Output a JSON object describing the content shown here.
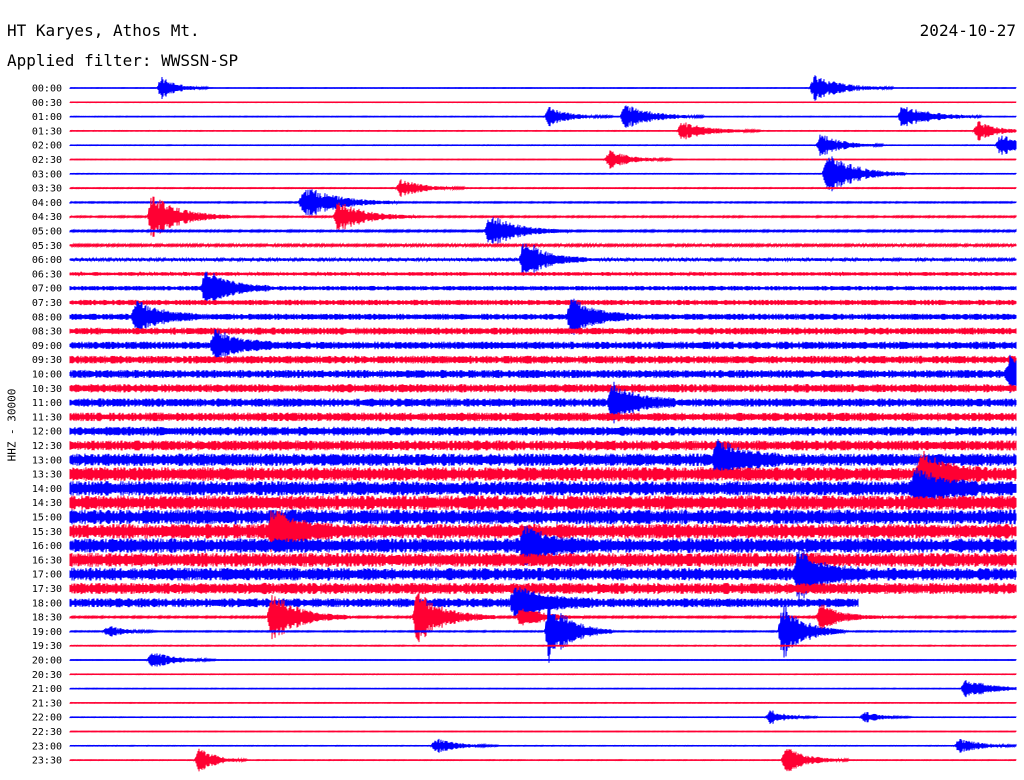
{
  "header": {
    "station": "HT Karyes, Athos Mt.",
    "date": "2024-10-27",
    "filter": "Applied filter: WWSSN-SP"
  },
  "colors": {
    "trace_even": "#0000ff",
    "trace_odd": "#ff0033",
    "background": "#ffffff",
    "text": "#000000"
  },
  "chart_data": {
    "type": "helicorder",
    "ylabel": "HHZ - 30000",
    "row_labels": [
      "00:00",
      "00:30",
      "01:00",
      "01:30",
      "02:00",
      "02:30",
      "03:00",
      "03:30",
      "04:00",
      "04:30",
      "05:00",
      "05:30",
      "06:00",
      "06:30",
      "07:00",
      "07:30",
      "08:00",
      "08:30",
      "09:00",
      "09:30",
      "10:00",
      "10:30",
      "11:00",
      "11:30",
      "12:00",
      "12:30",
      "13:00",
      "13:30",
      "14:00",
      "14:30",
      "15:00",
      "15:30",
      "16:00",
      "16:30",
      "17:00",
      "17:30",
      "18:00",
      "18:30",
      "19:00",
      "19:30",
      "20:00",
      "20:30",
      "21:00",
      "21:30",
      "22:00",
      "22:30",
      "23:00",
      "23:30"
    ],
    "row_minutes": 30,
    "color_order": [
      "blue",
      "red"
    ],
    "noise_level": [
      0.15,
      0.15,
      0.2,
      0.2,
      0.2,
      0.2,
      0.25,
      0.3,
      0.4,
      0.5,
      0.6,
      0.8,
      1.0,
      1.3,
      1.6,
      1.9,
      2.2,
      2.5,
      2.7,
      2.8,
      2.9,
      3.0,
      3.0,
      3.1,
      3.2,
      3.6,
      4.5,
      5.0,
      5.2,
      5.2,
      5.3,
      5.3,
      5.2,
      5.0,
      4.6,
      4.0,
      3.2,
      0.6,
      0.4,
      0.3,
      0.25,
      0.2,
      0.2,
      0.2,
      0.2,
      0.2,
      0.2,
      0.2
    ],
    "bursts": [
      {
        "row": 0,
        "minute": 2.9,
        "amplitude": 12,
        "duration": 1.5
      },
      {
        "row": 0,
        "minute": 23.6,
        "amplitude": 14,
        "duration": 2.5
      },
      {
        "row": 2,
        "minute": 15.2,
        "amplitude": 10,
        "duration": 2.0
      },
      {
        "row": 2,
        "minute": 17.6,
        "amplitude": 14,
        "duration": 2.5
      },
      {
        "row": 2,
        "minute": 26.4,
        "amplitude": 14,
        "duration": 2.5
      },
      {
        "row": 3,
        "minute": 19.4,
        "amplitude": 10,
        "duration": 2.5
      },
      {
        "row": 3,
        "minute": 28.8,
        "amplitude": 10,
        "duration": 1.8
      },
      {
        "row": 4,
        "minute": 23.8,
        "amplitude": 12,
        "duration": 2.0
      },
      {
        "row": 4,
        "minute": 29.5,
        "amplitude": 12,
        "duration": 2.0
      },
      {
        "row": 5,
        "minute": 17.1,
        "amplitude": 10,
        "duration": 2.0
      },
      {
        "row": 6,
        "minute": 24.0,
        "amplitude": 24,
        "duration": 2.5
      },
      {
        "row": 7,
        "minute": 10.5,
        "amplitude": 10,
        "duration": 2.0
      },
      {
        "row": 8,
        "minute": 7.4,
        "amplitude": 18,
        "duration": 3.0
      },
      {
        "row": 9,
        "minute": 2.6,
        "amplitude": 24,
        "duration": 2.5
      },
      {
        "row": 9,
        "minute": 8.5,
        "amplitude": 16,
        "duration": 2.5
      },
      {
        "row": 10,
        "minute": 13.3,
        "amplitude": 18,
        "duration": 2.5
      },
      {
        "row": 12,
        "minute": 14.4,
        "amplitude": 22,
        "duration": 2.0
      },
      {
        "row": 14,
        "minute": 4.3,
        "amplitude": 20,
        "duration": 2.0
      },
      {
        "row": 16,
        "minute": 2.1,
        "amplitude": 18,
        "duration": 2.0
      },
      {
        "row": 16,
        "minute": 15.9,
        "amplitude": 20,
        "duration": 2.0
      },
      {
        "row": 18,
        "minute": 4.6,
        "amplitude": 16,
        "duration": 2.0
      },
      {
        "row": 20,
        "minute": 29.8,
        "amplitude": 18,
        "duration": 2.0
      },
      {
        "row": 22,
        "minute": 17.2,
        "amplitude": 20,
        "duration": 2.0
      },
      {
        "row": 26,
        "minute": 20.5,
        "amplitude": 20,
        "duration": 2.0
      },
      {
        "row": 27,
        "minute": 27.0,
        "amplitude": 22,
        "duration": 2.0
      },
      {
        "row": 28,
        "minute": 26.8,
        "amplitude": 20,
        "duration": 2.0
      },
      {
        "row": 31,
        "minute": 6.4,
        "amplitude": 20,
        "duration": 2.0
      },
      {
        "row": 32,
        "minute": 14.4,
        "amplitude": 18,
        "duration": 2.0
      },
      {
        "row": 34,
        "minute": 23.1,
        "amplitude": 24,
        "duration": 2.0
      },
      {
        "row": 36,
        "minute": 14.1,
        "amplitude": 18,
        "duration": 2.5
      },
      {
        "row": 37,
        "minute": 6.4,
        "amplitude": 26,
        "duration": 2.5
      },
      {
        "row": 37,
        "minute": 11.0,
        "amplitude": 28,
        "duration": 2.5
      },
      {
        "row": 37,
        "minute": 14.3,
        "amplitude": 12,
        "duration": 2.0
      },
      {
        "row": 37,
        "minute": 23.8,
        "amplitude": 14,
        "duration": 2.0
      },
      {
        "row": 38,
        "minute": 15.2,
        "amplitude": 34,
        "duration": 2.0
      },
      {
        "row": 38,
        "minute": 22.6,
        "amplitude": 30,
        "duration": 2.0
      },
      {
        "row": 38,
        "minute": 1.2,
        "amplitude": 6,
        "duration": 1.5
      },
      {
        "row": 40,
        "minute": 2.6,
        "amplitude": 9,
        "duration": 2.0
      },
      {
        "row": 42,
        "minute": 28.4,
        "amplitude": 10,
        "duration": 2.5
      },
      {
        "row": 44,
        "minute": 22.2,
        "amplitude": 8,
        "duration": 1.5
      },
      {
        "row": 44,
        "minute": 25.2,
        "amplitude": 6,
        "duration": 1.5
      },
      {
        "row": 46,
        "minute": 11.6,
        "amplitude": 8,
        "duration": 2.0
      },
      {
        "row": 46,
        "minute": 28.2,
        "amplitude": 8,
        "duration": 2.0
      },
      {
        "row": 47,
        "minute": 4.1,
        "amplitude": 14,
        "duration": 1.5
      },
      {
        "row": 47,
        "minute": 22.7,
        "amplitude": 14,
        "duration": 2.0
      }
    ],
    "gap": {
      "row": 36,
      "from_minute": 25.0,
      "to_minute": 30.0
    }
  }
}
